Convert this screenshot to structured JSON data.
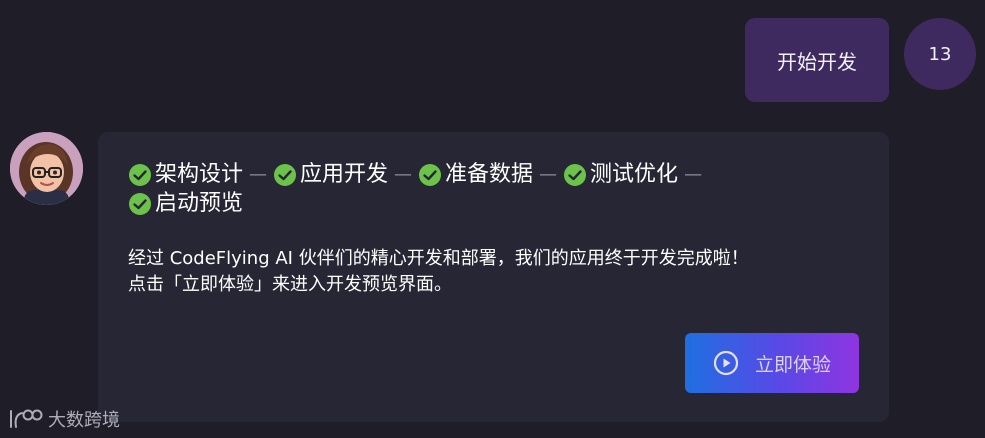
{
  "conversation": {
    "user_message": {
      "text": "开始开发",
      "avatar_text": "13"
    },
    "assistant_message": {
      "steps": [
        {
          "label": "架构设计",
          "status": "done"
        },
        {
          "label": "应用开发",
          "status": "done"
        },
        {
          "label": "准备数据",
          "status": "done"
        },
        {
          "label": "测试优化",
          "status": "done"
        },
        {
          "label": "启动预览",
          "status": "done"
        }
      ],
      "line1": "经过 CodeFlying AI 伙伴们的精心开发和部署，我们的应用终于开发完成啦！",
      "line2": "点击「立即体验」来进入开发预览界面。",
      "cta_label": "立即体验"
    }
  },
  "watermark": {
    "text": "大数跨境"
  },
  "colors": {
    "background": "#1f1e28",
    "user_bubble": "#3f2a60",
    "assistant_card": "#262635",
    "check_green": "#6cc24a",
    "cta_gradient_start": "#1f6fe0",
    "cta_gradient_end": "#8f35e0"
  },
  "icons": {
    "step_done": "check-circle-icon",
    "cta": "play-circle-icon",
    "watermark": "logo-icon"
  }
}
